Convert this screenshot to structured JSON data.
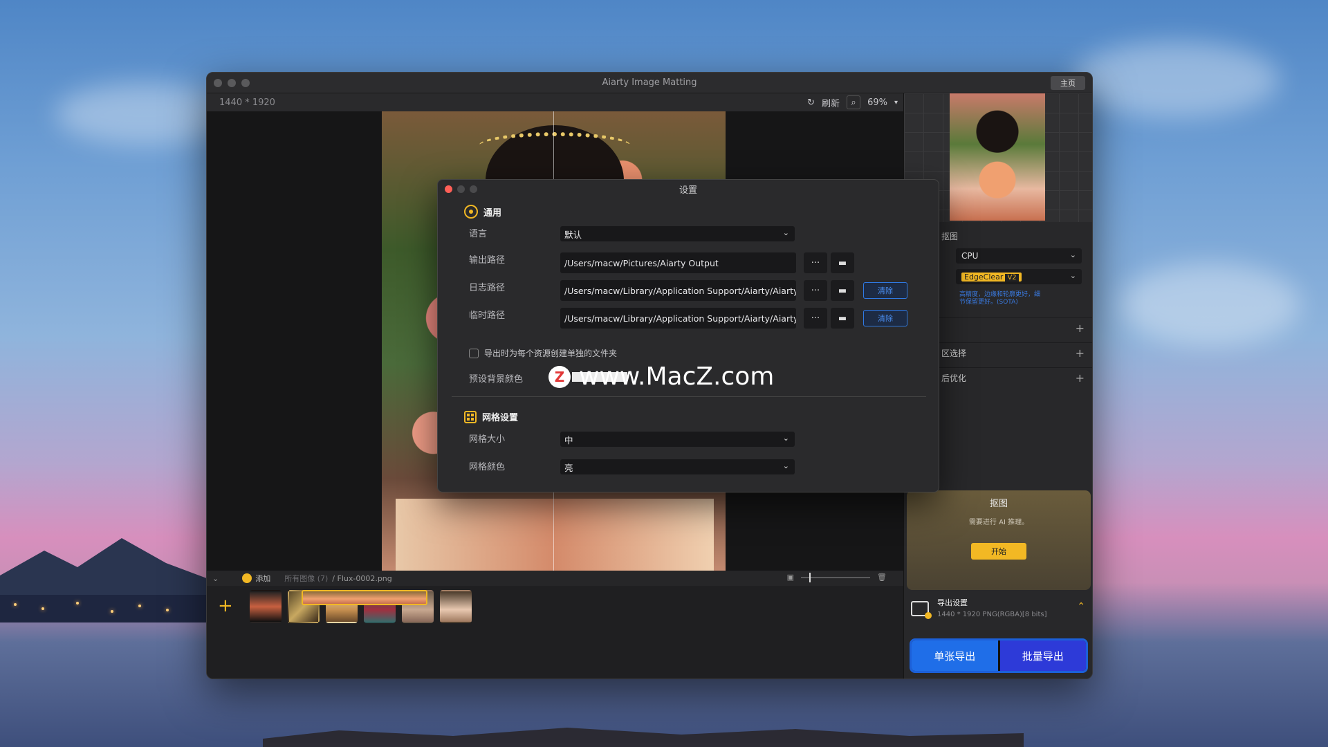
{
  "window": {
    "title": "Aiarty Image Matting",
    "home_label": "主页"
  },
  "toolbar": {
    "dimensions": "1440 * 1920",
    "refresh_label": "刷新",
    "zoom": "69%"
  },
  "filmstrip": {
    "add_label": "添加",
    "breadcrumb_all": "所有图像 (7)",
    "breadcrumb_file": "/ Flux-0002.png",
    "thumbnail_count": 7,
    "selected_index": 4
  },
  "side": {
    "section_matting": "抠图",
    "device": "CPU",
    "model": "EdgeClear",
    "model_version": "V2",
    "model_hint": "高精度，边缘和轮廓更好，细节保留更好。(SOTA)",
    "row1": "",
    "row2": "区选择",
    "row3": "后优化",
    "matte_title": "抠图",
    "matte_desc": "需要进行 AI 推理。",
    "start_label": "开始",
    "export_settings_title": "导出设置",
    "export_settings_desc": "1440 * 1920 PNG(RGBA)[8 bits]",
    "single_export": "单张导出",
    "batch_export": "批量导出"
  },
  "dialog": {
    "title": "设置",
    "general": {
      "heading": "通用",
      "language_label": "语言",
      "language_value": "默认",
      "output_label": "输出路径",
      "output_value": "/Users/macw/Pictures/Aiarty Output",
      "log_label": "日志路径",
      "log_value": "/Users/macw/Library/Application Support/Aiarty/Aiarty In",
      "temp_label": "临时路径",
      "temp_value": "/Users/macw/Library/Application Support/Aiarty/Aiarty In",
      "browse_label": "···",
      "clear_label": "清除",
      "folder_checkbox": "导出时为每个资源创建单独的文件夹",
      "bg_color_label": "预设背景颜色"
    },
    "grid": {
      "heading": "网格设置",
      "size_label": "网格大小",
      "size_value": "中",
      "color_label": "网格颜色",
      "color_value": "亮"
    }
  },
  "watermark": {
    "text": "www.MacZ.com",
    "logo": "Z"
  },
  "colors": {
    "accent": "#f2b824",
    "blue": "#1f6ee8",
    "purple": "#2d3ad8"
  }
}
